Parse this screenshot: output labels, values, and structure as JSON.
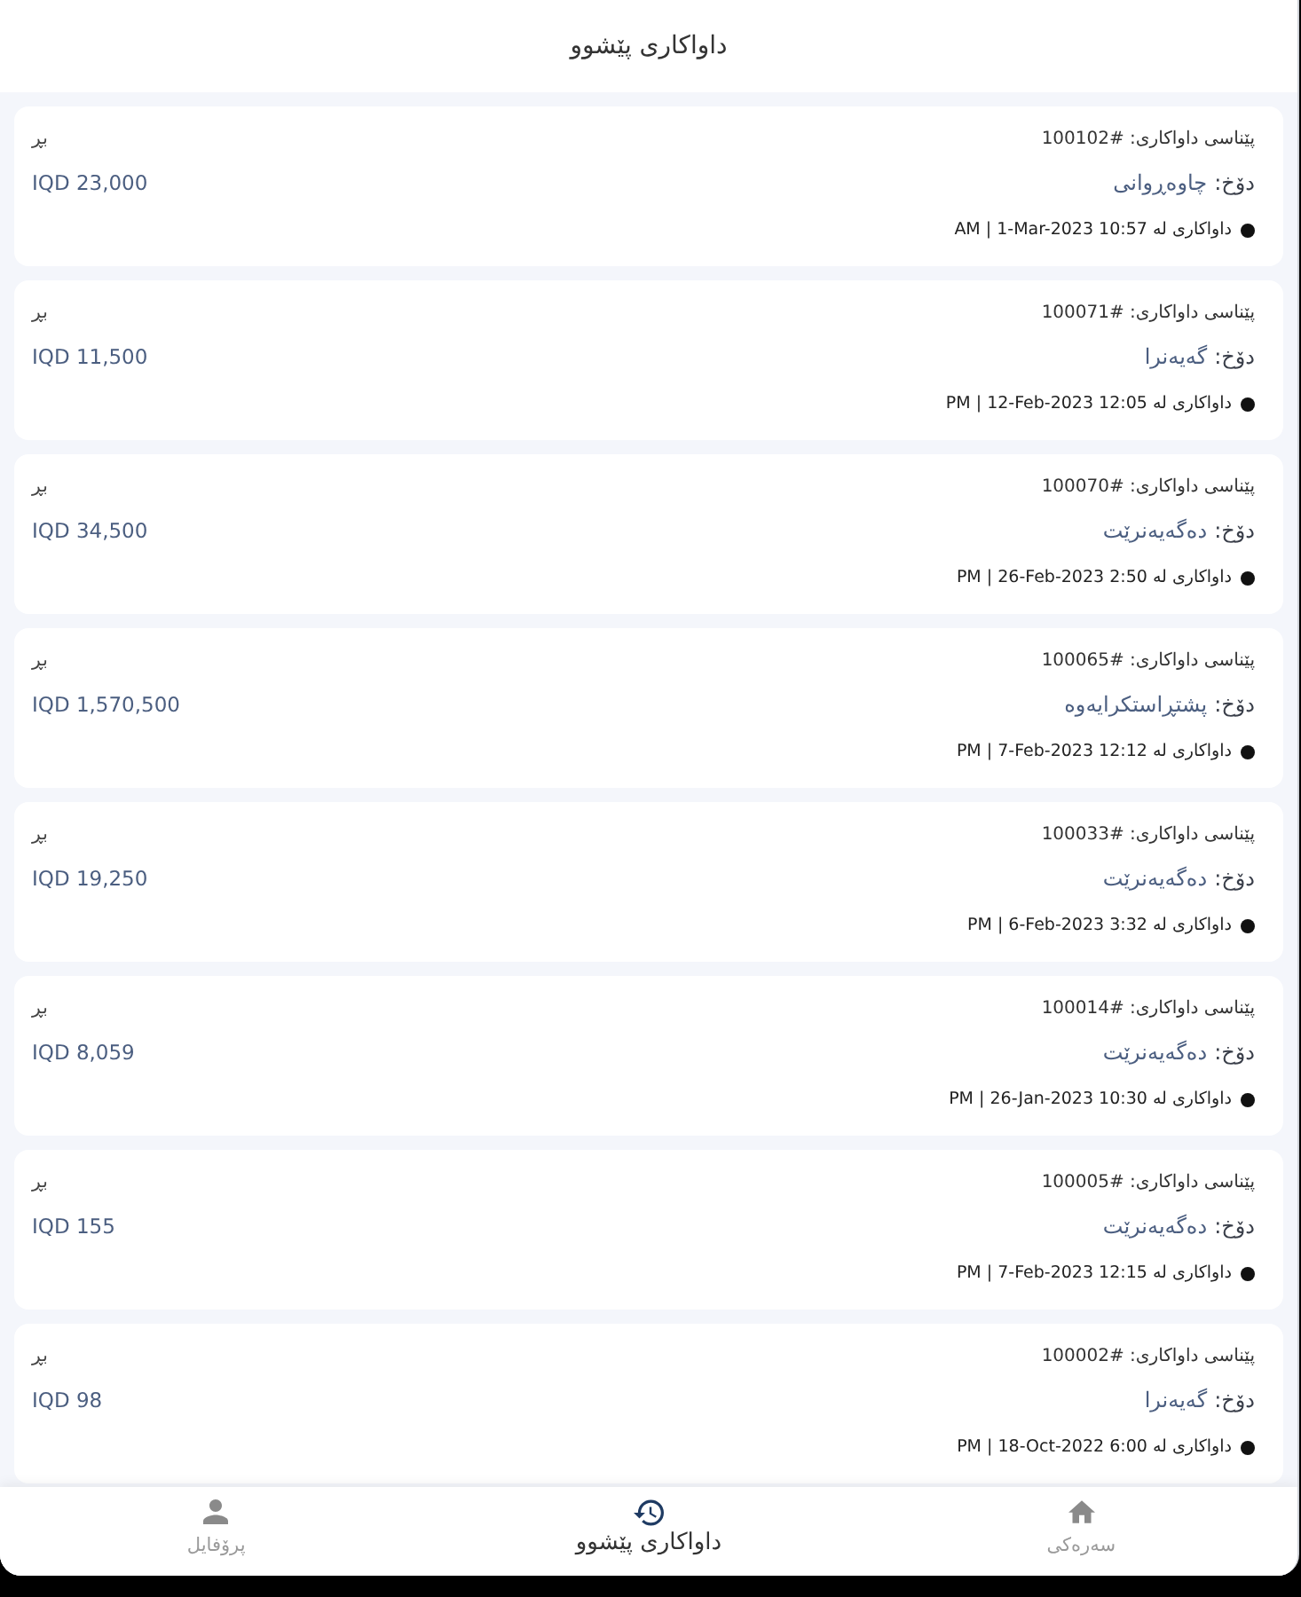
{
  "header": {
    "title": "داواکاری پێشوو"
  },
  "orders": [
    {
      "id_label": "پێناسی داواکاری: #100102",
      "status_label": "دۆخ:",
      "status": "چاوەڕوانی",
      "date": "داواکاری لە AM | 1-Mar-2023 10:57",
      "amount_label": "بڕ",
      "amount": "IQD 23,000"
    },
    {
      "id_label": "پێناسی داواکاری: #100071",
      "status_label": "دۆخ:",
      "status": "گەیەنرا",
      "date": "داواکاری لە PM | 12-Feb-2023 12:05",
      "amount_label": "بڕ",
      "amount": "IQD 11,500"
    },
    {
      "id_label": "پێناسی داواکاری: #100070",
      "status_label": "دۆخ:",
      "status": "دەگەیەنرێت",
      "date": "داواکاری لە PM | 26-Feb-2023 2:50",
      "amount_label": "بڕ",
      "amount": "IQD 34,500"
    },
    {
      "id_label": "پێناسی داواکاری: #100065",
      "status_label": "دۆخ:",
      "status": "پشتڕاستکرایەوە",
      "date": "داواکاری لە PM | 7-Feb-2023 12:12",
      "amount_label": "بڕ",
      "amount": "IQD 1,570,500"
    },
    {
      "id_label": "پێناسی داواکاری: #100033",
      "status_label": "دۆخ:",
      "status": "دەگەیەنرێت",
      "date": "داواکاری لە PM | 6-Feb-2023 3:32",
      "amount_label": "بڕ",
      "amount": "IQD 19,250"
    },
    {
      "id_label": "پێناسی داواکاری: #100014",
      "status_label": "دۆخ:",
      "status": "دەگەیەنرێت",
      "date": "داواکاری لە PM | 26-Jan-2023 10:30",
      "amount_label": "بڕ",
      "amount": "IQD 8,059"
    },
    {
      "id_label": "پێناسی داواکاری: #100005",
      "status_label": "دۆخ:",
      "status": "دەگەیەنرێت",
      "date": "داواکاری لە PM | 7-Feb-2023 12:15",
      "amount_label": "بڕ",
      "amount": "IQD 155"
    },
    {
      "id_label": "پێناسی داواکاری: #100002",
      "status_label": "دۆخ:",
      "status": "گەیەنرا",
      "date": "داواکاری لە PM | 18-Oct-2022 6:00",
      "amount_label": "بڕ",
      "amount": "IQD 98"
    }
  ],
  "bottom_nav": [
    {
      "kind": "home",
      "label": "سەرەکی",
      "selected": false
    },
    {
      "kind": "history",
      "label": "داواکاری پێشوو",
      "selected": true
    },
    {
      "kind": "profile",
      "label": "پرۆفایل",
      "selected": false
    }
  ]
}
